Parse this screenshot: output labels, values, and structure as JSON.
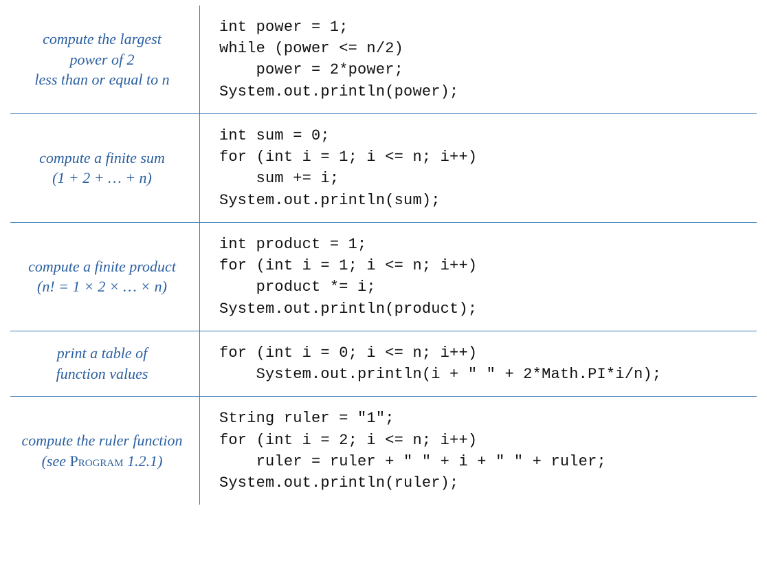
{
  "rows": [
    {
      "label_lines": [
        "compute the largest",
        "power of 2",
        "less than or equal to n"
      ],
      "code": "int power = 1;\nwhile (power <= n/2)\n    power = 2*power;\nSystem.out.println(power);"
    },
    {
      "label_lines": [
        "compute a finite sum",
        "(1 + 2 + … + n)"
      ],
      "code": "int sum = 0;\nfor (int i = 1; i <= n; i++)\n    sum += i;\nSystem.out.println(sum);"
    },
    {
      "label_lines": [
        "compute a finite product",
        "(n! = 1 × 2 ×  … × n)"
      ],
      "code": "int product = 1;\nfor (int i = 1; i <= n; i++)\n    product *= i;\nSystem.out.println(product);"
    },
    {
      "label_lines": [
        "print a table of",
        "function values"
      ],
      "code": "for (int i = 0; i <= n; i++)\n    System.out.println(i + \" \" + 2*Math.PI*i/n);"
    },
    {
      "label_lines": [
        "compute the ruler function",
        "(see PROGRAM 1.2.1)"
      ],
      "code": "String ruler = \"1\";\nfor (int i = 2; i <= n; i++)\n    ruler = ruler + \" \" + i + \" \" + ruler;\nSystem.out.println(ruler);"
    }
  ]
}
